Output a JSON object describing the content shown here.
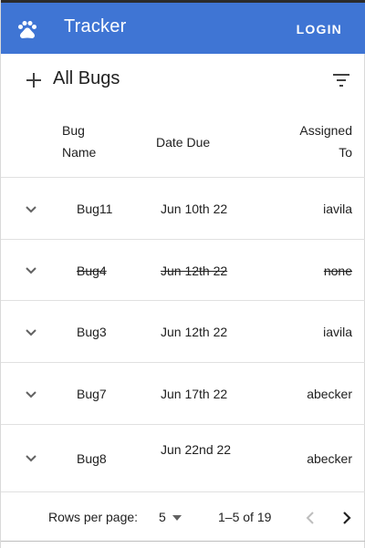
{
  "app": {
    "title": "Tracker",
    "login_label": "LOGIN",
    "bar_color": "#3f75d4"
  },
  "toolbar": {
    "title": "All Bugs"
  },
  "table": {
    "headers": {
      "name_line1": "Bug",
      "name_line2": "Name",
      "date": "Date Due",
      "assigned_line1": "Assigned",
      "assigned_line2": "To"
    },
    "rows": [
      {
        "name": "Bug11",
        "date": "Jun 10th 22",
        "assigned": "iavila",
        "closed": false
      },
      {
        "name": "Bug4",
        "date": "Jun 12th 22",
        "assigned": "none",
        "closed": true
      },
      {
        "name": "Bug3",
        "date": "Jun 12th 22",
        "assigned": "iavila",
        "closed": false
      },
      {
        "name": "Bug7",
        "date": "Jun 17th 22",
        "assigned": "abecker",
        "closed": false
      },
      {
        "name": "Bug8",
        "date": "Jun 22nd 22",
        "assigned": "abecker",
        "closed": false
      }
    ]
  },
  "pagination": {
    "rows_per_page_label": "Rows per page:",
    "rows_per_page": "5",
    "range": "1–5 of 19"
  },
  "icons": {
    "paw": "paw-icon",
    "add": "plus-icon",
    "filter": "filter-list-icon",
    "expand": "chevron-down-icon",
    "dropdown": "arrow-drop-down-icon",
    "prev": "chevron-left-icon",
    "next": "chevron-right-icon"
  }
}
